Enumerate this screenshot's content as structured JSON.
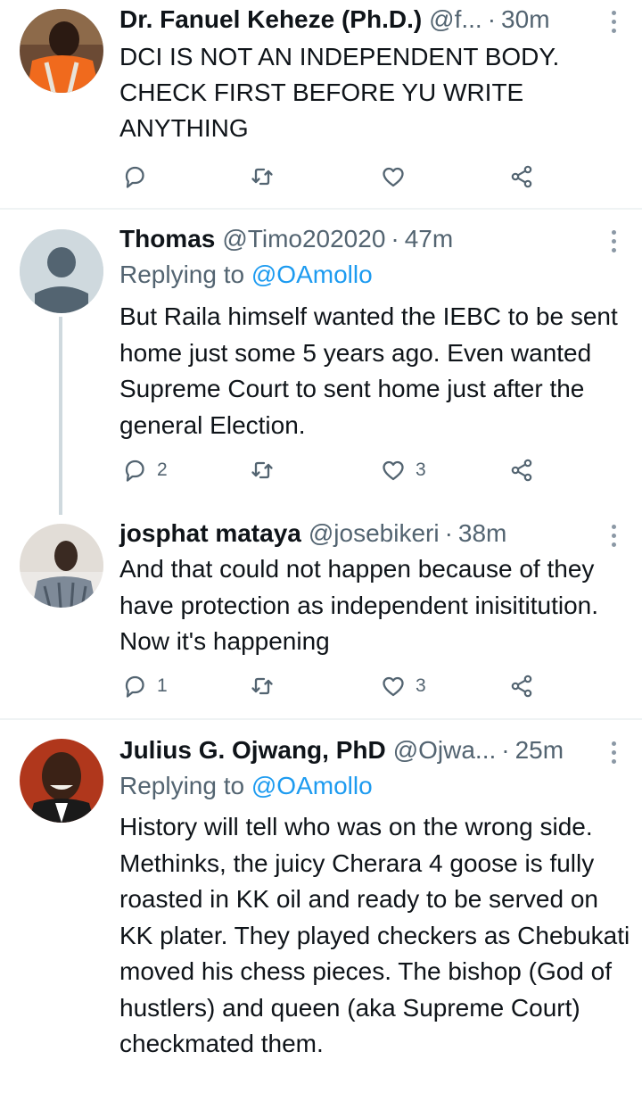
{
  "tweets": [
    {
      "name": "Dr. Fanuel Keheze (Ph.D.)",
      "handle": "@f...",
      "separator": "·",
      "time": "30m",
      "text": "DCI IS NOT AN INDEPENDENT BODY.\nCHECK FIRST BEFORE YU WRITE\nANYTHING",
      "reply_count": "",
      "like_count": ""
    },
    {
      "name": "Thomas",
      "handle": "@Timo202020",
      "separator": "·",
      "time": "47m",
      "replying_prefix": "Replying to",
      "replying_to": "@OAmollo",
      "text": "But Raila himself wanted the IEBC to be sent home just some 5 years ago. Even wanted Supreme Court to sent home just after the general Election.",
      "reply_count": "2",
      "like_count": "3"
    },
    {
      "name": "josphat mataya",
      "handle": "@josebikeri",
      "separator": "·",
      "time": "38m",
      "text": "And that could not happen because of they have protection as independent inisititution. Now it's happening",
      "reply_count": "1",
      "like_count": "3"
    },
    {
      "name": "Julius G. Ojwang, PhD",
      "handle": "@Ojwa...",
      "separator": "·",
      "time": "25m",
      "replying_prefix": "Replying to",
      "replying_to": "@OAmollo",
      "text": "History will tell who was on the wrong side. Methinks, the juicy Cherara 4 goose is fully roasted in KK oil and ready to be served on KK plater. They played checkers as Chebukati moved his chess pieces. The bishop (God of hustlers) and queen (aka Supreme Court) checkmated them.",
      "reply_count": "",
      "like_count": ""
    }
  ],
  "colors": {
    "text": "#0f1419",
    "secondary": "#536471",
    "mention": "#1d9bf0",
    "divider": "#eff3f4"
  }
}
